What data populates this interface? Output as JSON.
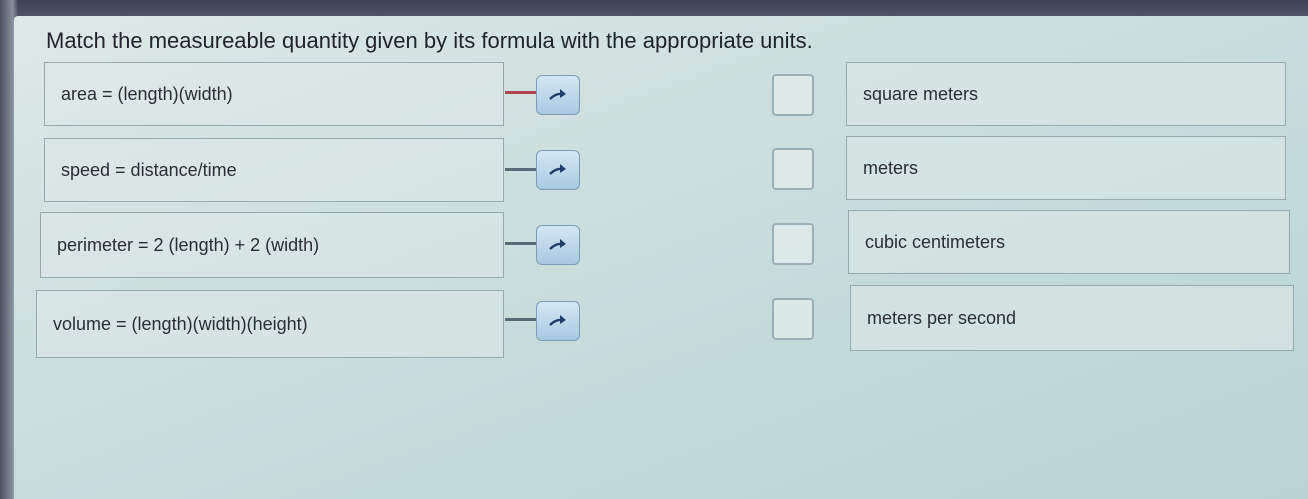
{
  "question": {
    "text": "Match the measureable quantity given by its formula with the appropriate units."
  },
  "formulas": [
    {
      "label": "area = (length)(width)"
    },
    {
      "label": "speed = distance/time"
    },
    {
      "label": "perimeter = 2 (length) + 2 (width)"
    },
    {
      "label": "volume = (length)(width)(height)"
    }
  ],
  "units": [
    {
      "label": "square meters"
    },
    {
      "label": "meters"
    },
    {
      "label": "cubic centimeters"
    },
    {
      "label": "meters per second"
    }
  ],
  "icons": {
    "match_button": "arrow-right-icon",
    "target": "checkbox-icon"
  },
  "colors": {
    "active_connector": "#b0464c",
    "connector": "#5a6b78",
    "arrow": "#1f3d66"
  }
}
